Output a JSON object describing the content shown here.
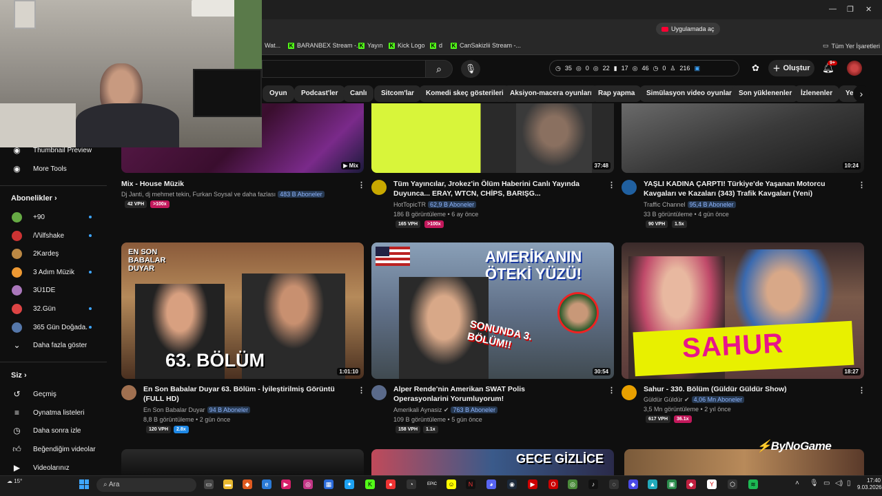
{
  "browser": {
    "install_pill": "Uygulamada aç",
    "bookmarks": [
      "Wat...",
      "BARANBEX Stream -...",
      "Yayın",
      "Kick Logo",
      "d",
      "CanSakizlii Stream -..."
    ],
    "all_bookmarks": "Tüm Yer İşaretleri",
    "window_controls": [
      "—",
      "❐",
      "✕"
    ]
  },
  "header": {
    "stats": [
      "35",
      "0",
      "22",
      "17",
      "46",
      "0",
      "216"
    ],
    "create_label": "Oluştur",
    "notif_badge": "9+"
  },
  "chips": [
    "Oyun",
    "Podcast'ler",
    "Canlı",
    "Sitcom'lar",
    "Komedi skeç gösterileri",
    "Aksiyon-macera oyunları",
    "Rap yapma",
    "Simülasyon video oyunları",
    "Son yüklenenler",
    "İzlenenler",
    "Yer"
  ],
  "sidebar": {
    "tools": [
      "Thumbnail Preview",
      "More Tools"
    ],
    "subs_heading": "Abonelikler",
    "subs": [
      "+90",
      "/\\/\\ilfshake",
      "2Kardeş",
      "3 Adım Müzik",
      "3Ü1DE",
      "32.Gün",
      "365 Gün Doğada..."
    ],
    "show_more": "Daha fazla göster",
    "you_heading": "Siz",
    "you_items": [
      "Geçmiş",
      "Oynatma listeleri",
      "Daha sonra izle",
      "Beğendiğim videolar",
      "Videolarınız"
    ]
  },
  "videos_row1": [
    {
      "title": "Mix - House Müzik",
      "channel": "Dj Janti, dj mehmet tekin, Furkan Soysal ve daha fazlası",
      "subs": "483 B Aboneler",
      "meta": "",
      "tags": [
        "42 VPH",
        ">100x"
      ],
      "duration": "Mix"
    },
    {
      "title": "Tüm Yayıncılar, Jrokez'in Ölüm Haberini Canlı Yayında Duyunca... ERAY, WTCN, CHİPS, BARIŞG...",
      "channel": "HotTopicTR",
      "subs": "62,9 B Aboneler",
      "meta": "186 B görüntüleme • 6 ay önce",
      "tags": [
        "165 VPH",
        ">100x"
      ],
      "duration": "37:48"
    },
    {
      "title": "YAŞLI KADINA ÇARPTI! Türkiye'de Yaşanan Motorcu Kavgaları ve Kazaları (343) Trafik Kavgaları (Yeni)",
      "channel": "Traffic Channel",
      "subs": "95,4 B Aboneler",
      "meta": "33 B görüntüleme • 4 gün önce",
      "tags": [
        "90 VPH",
        "1.5x"
      ],
      "duration": "10:24"
    }
  ],
  "videos_row2": [
    {
      "title": "En Son Babalar Duyar 63. Bölüm - İyileştirilmiş Görüntü (FULL HD)",
      "channel": "En Son Babalar Duyar",
      "subs": "94 B Aboneler",
      "meta": "8,8 B görüntüleme • 2 gün önce",
      "tags": [
        "120 VPH",
        "2.8x"
      ],
      "duration": "1:01:10",
      "thumb_text": "63. BÖLÜM",
      "thumb_small": "EN SON BABALAR DUYAR"
    },
    {
      "title": "Alper Rende'nin Amerikan SWAT Polis Operasyonlarini Yorumluyorum!",
      "channel": "Amerikali Aynasiz",
      "subs": "763 B Aboneler",
      "meta": "109 B görüntüleme • 5 gün önce",
      "tags": [
        "158 VPH",
        "1.1x"
      ],
      "duration": "30:54",
      "thumb_text": "AMERİKANIN ÖTEKİ YÜZÜ!",
      "thumb_small": "SONUNDA 3. BÖLÜM!!"
    },
    {
      "title": "Sahur - 330. Bölüm (Güldür Güldür Show)",
      "channel": "Güldür Güldür",
      "subs": "4,06 Mn Aboneler",
      "meta": "3,5 Mn görüntüleme • 2 yıl önce",
      "tags": [
        "617 VPH",
        "36.1x"
      ],
      "duration": "18:27",
      "thumb_text": "SAHUR",
      "thumb_small": ""
    }
  ],
  "row3_text": "GECE GİZLİCE",
  "watermark": "ByNoGame",
  "taskbar": {
    "weather": "15°",
    "search_placeholder": "Ara",
    "time": "17:40",
    "date": "9.03.2026"
  },
  "colors": {
    "accent_red": "#ff0033",
    "sub_pill": "#8fb6ff",
    "tag_pink": "#c2185b",
    "tag_blue": "#1e88e5"
  }
}
